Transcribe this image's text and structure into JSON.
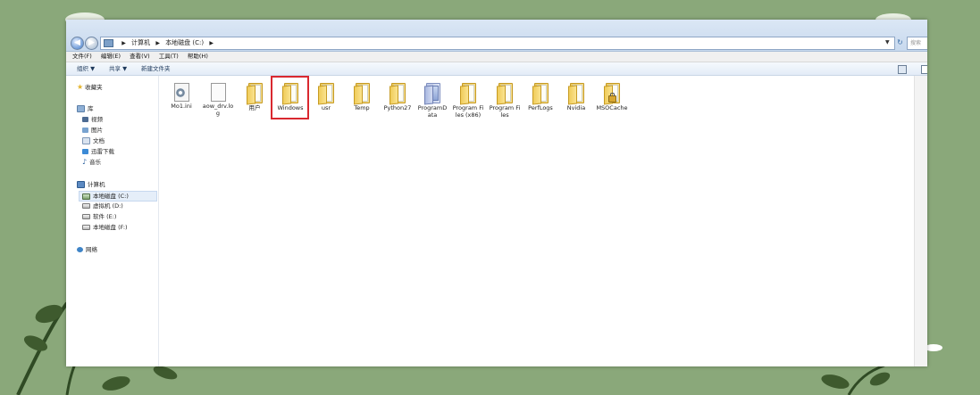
{
  "address": {
    "crumbs": [
      "计算机",
      "本地磁盘 (C:)"
    ],
    "search_placeholder": "搜索"
  },
  "menu": [
    "文件(F)",
    "编辑(E)",
    "查看(V)",
    "工具(T)",
    "帮助(H)"
  ],
  "toolbar": {
    "organize": "组织 ▼",
    "share": "共享 ▼",
    "new_folder": "新建文件夹"
  },
  "sidebar": {
    "favorites": "收藏夹",
    "libraries": "库",
    "lib_items": [
      "视频",
      "图片",
      "文档",
      "迅雷下载",
      "音乐"
    ],
    "computer": "计算机",
    "drives": [
      "本地磁盘 (C:)",
      "虚拟机 (D:)",
      "软件 (E:)",
      "本地磁盘 (F:)"
    ],
    "network": "网络"
  },
  "files": [
    {
      "name": "Mo1.ini",
      "icon": "gear-file-icon"
    },
    {
      "name": "aow_drv.log",
      "icon": "log-file-icon"
    },
    {
      "name": "用户",
      "icon": "folder-icon"
    },
    {
      "name": "Windows",
      "icon": "folder-icon"
    },
    {
      "name": "usr",
      "icon": "folder-icon"
    },
    {
      "name": "Temp",
      "icon": "folder-icon"
    },
    {
      "name": "Python27",
      "icon": "folder-icon"
    },
    {
      "name": "ProgramData",
      "icon": "folder-blue-icon"
    },
    {
      "name": "Program Files (x86)",
      "icon": "folder-icon"
    },
    {
      "name": "Program Files",
      "icon": "folder-icon"
    },
    {
      "name": "PerfLogs",
      "icon": "folder-icon"
    },
    {
      "name": "Nvidia",
      "icon": "folder-icon"
    },
    {
      "name": "MSOCache",
      "icon": "folder-lock-icon"
    }
  ],
  "highlighted_file": "Windows",
  "colors": {
    "highlight": "#d9282f",
    "background": "#8aa87a"
  }
}
